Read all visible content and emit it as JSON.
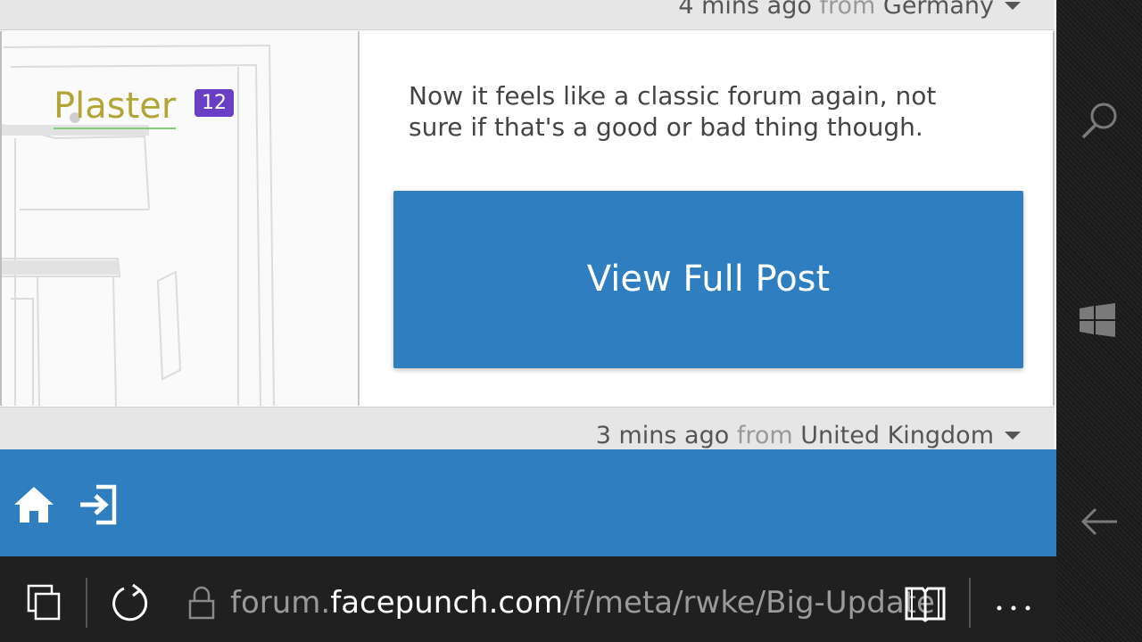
{
  "meta_top": {
    "time": "4 mins ago",
    "from": "from",
    "country": "Germany"
  },
  "post": {
    "username": "Plaster",
    "badge": "12",
    "text": "Now it feels like a classic forum again, not sure if that's a good or bad thing though.",
    "view_button": "View Full Post"
  },
  "meta_bottom": {
    "time": "3 mins ago",
    "from": "from",
    "country": "United Kingdom"
  },
  "footer_nav": {
    "icons": [
      "home-icon",
      "sign-in-icon"
    ]
  },
  "browser": {
    "url_prefix": "forum.",
    "url_domain": "facepunch.com",
    "url_path": "/f/meta/rwke/Big-Update"
  },
  "side_panel": {
    "icons": [
      "search-icon",
      "windows-icon",
      "back-arrow-icon"
    ]
  },
  "colors": {
    "accent": "#2e7ec0",
    "username": "#b3a535",
    "badge": "#6a3fc6"
  }
}
